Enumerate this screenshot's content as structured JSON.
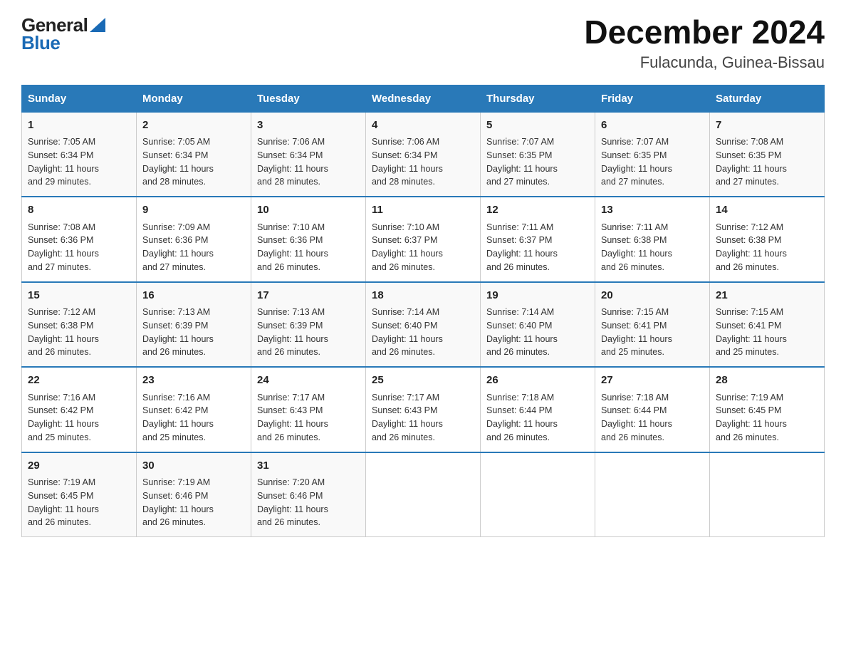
{
  "logo": {
    "general": "General",
    "blue": "Blue"
  },
  "title": "December 2024",
  "subtitle": "Fulacunda, Guinea-Bissau",
  "days_of_week": [
    "Sunday",
    "Monday",
    "Tuesday",
    "Wednesday",
    "Thursday",
    "Friday",
    "Saturday"
  ],
  "weeks": [
    [
      {
        "day": "1",
        "sunrise": "7:05 AM",
        "sunset": "6:34 PM",
        "daylight": "11 hours and 29 minutes."
      },
      {
        "day": "2",
        "sunrise": "7:05 AM",
        "sunset": "6:34 PM",
        "daylight": "11 hours and 28 minutes."
      },
      {
        "day": "3",
        "sunrise": "7:06 AM",
        "sunset": "6:34 PM",
        "daylight": "11 hours and 28 minutes."
      },
      {
        "day": "4",
        "sunrise": "7:06 AM",
        "sunset": "6:34 PM",
        "daylight": "11 hours and 28 minutes."
      },
      {
        "day": "5",
        "sunrise": "7:07 AM",
        "sunset": "6:35 PM",
        "daylight": "11 hours and 27 minutes."
      },
      {
        "day": "6",
        "sunrise": "7:07 AM",
        "sunset": "6:35 PM",
        "daylight": "11 hours and 27 minutes."
      },
      {
        "day": "7",
        "sunrise": "7:08 AM",
        "sunset": "6:35 PM",
        "daylight": "11 hours and 27 minutes."
      }
    ],
    [
      {
        "day": "8",
        "sunrise": "7:08 AM",
        "sunset": "6:36 PM",
        "daylight": "11 hours and 27 minutes."
      },
      {
        "day": "9",
        "sunrise": "7:09 AM",
        "sunset": "6:36 PM",
        "daylight": "11 hours and 27 minutes."
      },
      {
        "day": "10",
        "sunrise": "7:10 AM",
        "sunset": "6:36 PM",
        "daylight": "11 hours and 26 minutes."
      },
      {
        "day": "11",
        "sunrise": "7:10 AM",
        "sunset": "6:37 PM",
        "daylight": "11 hours and 26 minutes."
      },
      {
        "day": "12",
        "sunrise": "7:11 AM",
        "sunset": "6:37 PM",
        "daylight": "11 hours and 26 minutes."
      },
      {
        "day": "13",
        "sunrise": "7:11 AM",
        "sunset": "6:38 PM",
        "daylight": "11 hours and 26 minutes."
      },
      {
        "day": "14",
        "sunrise": "7:12 AM",
        "sunset": "6:38 PM",
        "daylight": "11 hours and 26 minutes."
      }
    ],
    [
      {
        "day": "15",
        "sunrise": "7:12 AM",
        "sunset": "6:38 PM",
        "daylight": "11 hours and 26 minutes."
      },
      {
        "day": "16",
        "sunrise": "7:13 AM",
        "sunset": "6:39 PM",
        "daylight": "11 hours and 26 minutes."
      },
      {
        "day": "17",
        "sunrise": "7:13 AM",
        "sunset": "6:39 PM",
        "daylight": "11 hours and 26 minutes."
      },
      {
        "day": "18",
        "sunrise": "7:14 AM",
        "sunset": "6:40 PM",
        "daylight": "11 hours and 26 minutes."
      },
      {
        "day": "19",
        "sunrise": "7:14 AM",
        "sunset": "6:40 PM",
        "daylight": "11 hours and 26 minutes."
      },
      {
        "day": "20",
        "sunrise": "7:15 AM",
        "sunset": "6:41 PM",
        "daylight": "11 hours and 25 minutes."
      },
      {
        "day": "21",
        "sunrise": "7:15 AM",
        "sunset": "6:41 PM",
        "daylight": "11 hours and 25 minutes."
      }
    ],
    [
      {
        "day": "22",
        "sunrise": "7:16 AM",
        "sunset": "6:42 PM",
        "daylight": "11 hours and 25 minutes."
      },
      {
        "day": "23",
        "sunrise": "7:16 AM",
        "sunset": "6:42 PM",
        "daylight": "11 hours and 25 minutes."
      },
      {
        "day": "24",
        "sunrise": "7:17 AM",
        "sunset": "6:43 PM",
        "daylight": "11 hours and 26 minutes."
      },
      {
        "day": "25",
        "sunrise": "7:17 AM",
        "sunset": "6:43 PM",
        "daylight": "11 hours and 26 minutes."
      },
      {
        "day": "26",
        "sunrise": "7:18 AM",
        "sunset": "6:44 PM",
        "daylight": "11 hours and 26 minutes."
      },
      {
        "day": "27",
        "sunrise": "7:18 AM",
        "sunset": "6:44 PM",
        "daylight": "11 hours and 26 minutes."
      },
      {
        "day": "28",
        "sunrise": "7:19 AM",
        "sunset": "6:45 PM",
        "daylight": "11 hours and 26 minutes."
      }
    ],
    [
      {
        "day": "29",
        "sunrise": "7:19 AM",
        "sunset": "6:45 PM",
        "daylight": "11 hours and 26 minutes."
      },
      {
        "day": "30",
        "sunrise": "7:19 AM",
        "sunset": "6:46 PM",
        "daylight": "11 hours and 26 minutes."
      },
      {
        "day": "31",
        "sunrise": "7:20 AM",
        "sunset": "6:46 PM",
        "daylight": "11 hours and 26 minutes."
      },
      null,
      null,
      null,
      null
    ]
  ],
  "labels": {
    "sunrise": "Sunrise:",
    "sunset": "Sunset:",
    "daylight": "Daylight:"
  }
}
